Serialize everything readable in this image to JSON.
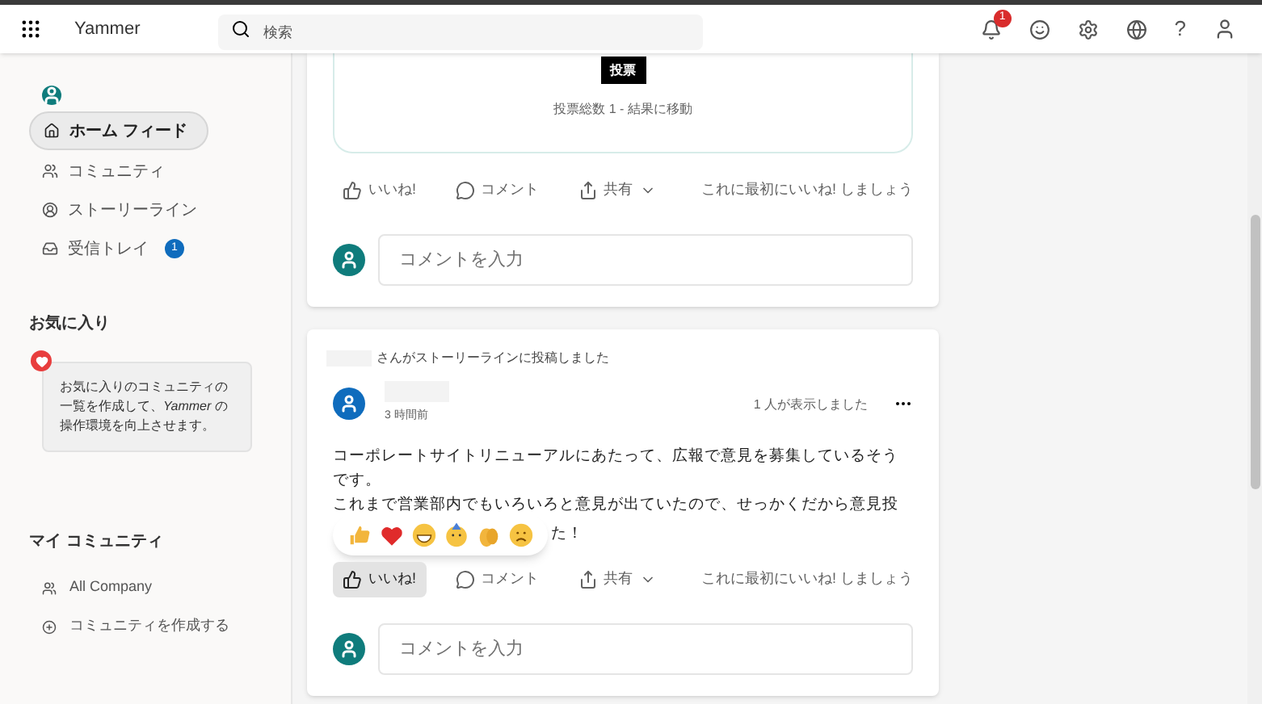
{
  "app": {
    "title": "Yammer",
    "notification_count": "1",
    "help": "?"
  },
  "search": {
    "placeholder": "検索"
  },
  "sidebar": {
    "items": [
      {
        "label": "ホーム フィード",
        "selected": true,
        "kind": "home"
      },
      {
        "label": "コミュニティ",
        "selected": false,
        "kind": "community"
      },
      {
        "label": "ストーリーライン",
        "selected": false,
        "kind": "storyline"
      },
      {
        "label": "受信トレイ",
        "selected": false,
        "kind": "inbox",
        "badge": "1"
      }
    ],
    "favorites": {
      "title": "お気に入り",
      "hint": "お気に入りのコミュニティの一覧を作成して、*Yammer* の操作環境を向上させます。"
    },
    "my_communities": {
      "title": "マイ コミュニティ",
      "items": [
        {
          "label": "All Company",
          "kind": "community"
        },
        {
          "label": "コミュニティを作成する",
          "kind": "create"
        }
      ]
    }
  },
  "posts": [
    {
      "poll": {
        "vote_button": "投票",
        "summary": "投票総数 1 - 結果に移動"
      },
      "actions": {
        "like": "いいね!",
        "like_selected": false,
        "comment": "コメント",
        "share": "共有",
        "like_prompt": "これに最初にいいね! しましょう"
      },
      "comment_placeholder": "コメントを入力"
    },
    {
      "activity": "さんがストーリーラインに投稿しました",
      "time": "3 時間前",
      "views": "1 人が表示しました",
      "body": [
        "コーポレートサイトリニューアルにあたって、広報で意見を募集しているそうです。",
        "これまで営業部内でもいろいろと意見が出ていたので、せっかくだから意見投"
      ],
      "body_tail": "た！",
      "reactions": [
        {
          "kind": "thumb"
        },
        {
          "kind": "heart"
        },
        {
          "kind": "grin"
        },
        {
          "kind": "party"
        },
        {
          "kind": "clap"
        },
        {
          "kind": "sad"
        }
      ],
      "actions": {
        "like": "いいね!",
        "like_selected": true,
        "comment": "コメント",
        "share": "共有",
        "like_prompt": "これに最初にいいね! しましょう"
      },
      "comment_placeholder": "コメントを入力"
    }
  ]
}
